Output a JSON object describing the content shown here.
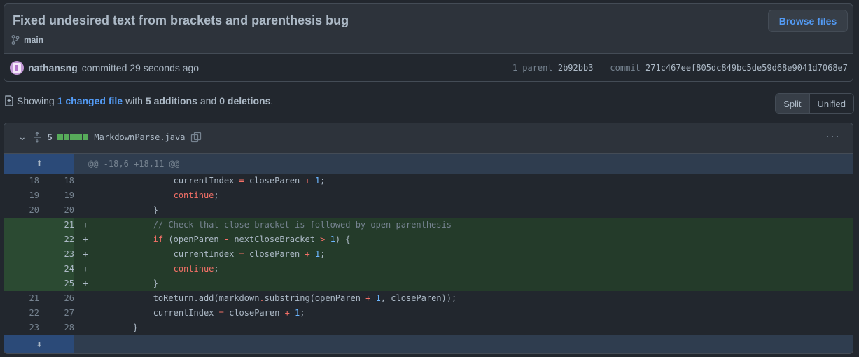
{
  "commit": {
    "title": "Fixed undesired text from brackets and parenthesis bug",
    "branch": "main",
    "browse_label": "Browse files",
    "author": "nathansng",
    "action": "committed 29 seconds ago",
    "parent_label": "1 parent",
    "parent_sha": "2b92bb3",
    "commit_label": "commit",
    "commit_sha": "271c467eef805dc849bc5de59d68e9041d7068e7"
  },
  "summary": {
    "prefix": "Showing",
    "changed": "1 changed file",
    "with": "with",
    "additions": "5 additions",
    "and": "and",
    "deletions": "0 deletions",
    "period": "."
  },
  "view_toggle": {
    "split": "Split",
    "unified": "Unified",
    "selected": "Split"
  },
  "file": {
    "change_count": "5",
    "name": "MarkdownParse.java",
    "hunk": "@@ -18,6 +18,11 @@",
    "lines": [
      {
        "old": "18",
        "new": "18",
        "sign": "",
        "type": "ctx"
      },
      {
        "old": "19",
        "new": "19",
        "sign": "",
        "type": "ctx"
      },
      {
        "old": "20",
        "new": "20",
        "sign": "",
        "type": "ctx"
      },
      {
        "old": "",
        "new": "21",
        "sign": "+",
        "type": "add"
      },
      {
        "old": "",
        "new": "22",
        "sign": "+",
        "type": "add"
      },
      {
        "old": "",
        "new": "23",
        "sign": "+",
        "type": "add"
      },
      {
        "old": "",
        "new": "24",
        "sign": "+",
        "type": "add"
      },
      {
        "old": "",
        "new": "25",
        "sign": "+",
        "type": "add"
      },
      {
        "old": "21",
        "new": "26",
        "sign": "",
        "type": "ctx"
      },
      {
        "old": "22",
        "new": "27",
        "sign": "",
        "type": "ctx"
      },
      {
        "old": "23",
        "new": "28",
        "sign": "",
        "type": "ctx"
      }
    ]
  },
  "colors": {
    "addition": "#57ab5a",
    "link": "#539bf5",
    "keyword": "#f47067",
    "number": "#6cb6ff"
  }
}
